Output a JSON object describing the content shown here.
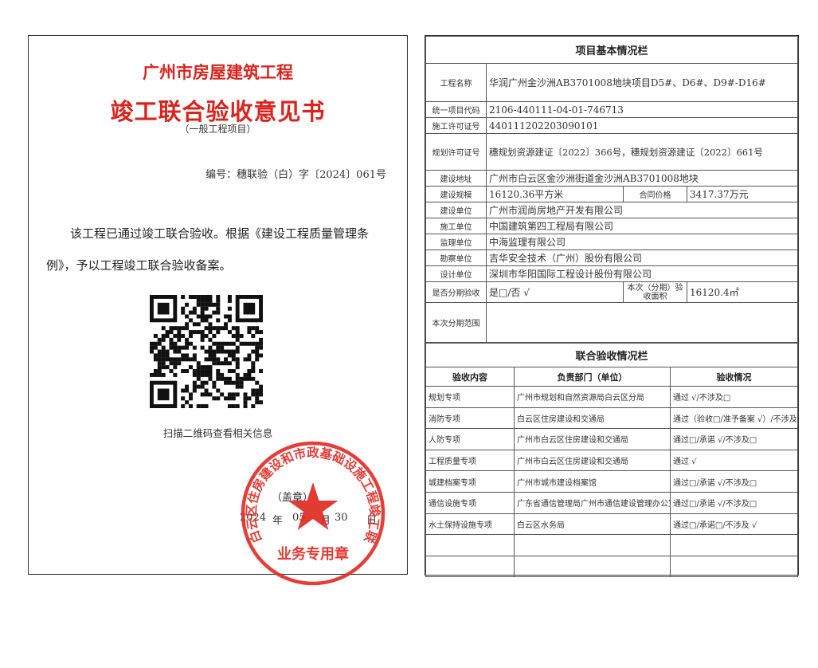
{
  "certificate": {
    "title_line1": "广州市房屋建筑工程",
    "title_line2": "竣工联合验收意见书",
    "subtitle": "（一般工程项目）",
    "doc_number": "编号：穗联验（白）字〔2024〕061号",
    "body_text": "该工程已通过竣工联合验收。根据《建设工程质量管理条例》，予以工程竣工联合验收备案。",
    "qr_caption": "扫描二维码查看相关信息",
    "seal_label": "（盖章）",
    "date_year": "2024",
    "date_year_unit": "年",
    "date_month": "05",
    "date_month_unit": "月",
    "date_day": "30",
    "date_day_unit": "日",
    "stamp_ring_text": "广州市白云区住房建设和市政基础设施工程竣工联合验收",
    "stamp_bottom_text": "业务专用章"
  },
  "project_info": {
    "section_title": "项目基本情况栏",
    "project_name_label": "工程名称",
    "project_name": "华润广州金沙洲AB3701008地块项目D5#、D6#、D9#-D16#",
    "project_code_label": "统一项目代码",
    "project_code": "2106-440111-04-01-746713",
    "construction_permit_label": "施工许可证号",
    "construction_permit": "440111202203090101",
    "planning_permit_label": "规划许可证号",
    "planning_permit": "穗规划资源建证〔2022〕366号，穗规划资源建证〔2022〕661号",
    "address_label": "建设地址",
    "address": "广州市白云区金沙洲街道金沙洲AB3701008地块",
    "scale_label": "建设规模",
    "scale": "16120.36平方米",
    "contract_price_label": "合同价格",
    "contract_price": "3417.37万元",
    "builder_label": "建设单位",
    "builder": "广州市润尚房地产开发有限公司",
    "contractor_label": "施工单位",
    "contractor": "中国建筑第四工程局有限公司",
    "supervisor_label": "监理单位",
    "supervisor": "中海监理有限公司",
    "surveyor_label": "勘察单位",
    "surveyor": "吉华安全技术（广州）股份有限公司",
    "designer_label": "设计单位",
    "designer": "深圳市华阳国际工程设计股份有限公司",
    "phased_label": "是否分期验收",
    "phased_value": "是□/否 √",
    "phase_area_label": "本次（分期）验收面积",
    "phase_area": "16120.4㎡",
    "phase_scope_label": "本次分期范围",
    "phase_scope": ""
  },
  "acceptance": {
    "section_title": "联合验收情况栏",
    "headers": [
      "验收内容",
      "负责部门（单位）",
      "验收情况"
    ],
    "rows": [
      {
        "item": "规划专项",
        "dept": "广州市规划和自然资源局白云区分局",
        "status": "通过 √/不涉及□"
      },
      {
        "item": "消防专项",
        "dept": "白云区住房建设和交通局",
        "status": "通过（验收□/准予备案 √）/不涉及□"
      },
      {
        "item": "人防专项",
        "dept": "广州市白云区住房建设和交通局",
        "status": "通过□/承诺 √/不涉及□"
      },
      {
        "item": "工程质量专项",
        "dept": "广州市白云区住房建设和交通局",
        "status": "通过 √"
      },
      {
        "item": "城建档案专项",
        "dept": "广州市城市建设档案馆",
        "status": "通过□/承诺 √/不涉及□"
      },
      {
        "item": "通信设施专项",
        "dept": "广东省通信管理局广州市通信建设管理办公室",
        "status": "通过□/承诺 √/不涉及□"
      },
      {
        "item": "水土保持设施专项",
        "dept": "白云区水务局",
        "status": "通过□/承诺□/不涉及 √"
      },
      {
        "item": "",
        "dept": "",
        "status": ""
      },
      {
        "item": "",
        "dept": "",
        "status": ""
      }
    ]
  },
  "colors": {
    "seal_red": "#e02a22",
    "title_red": "#d9241d"
  }
}
